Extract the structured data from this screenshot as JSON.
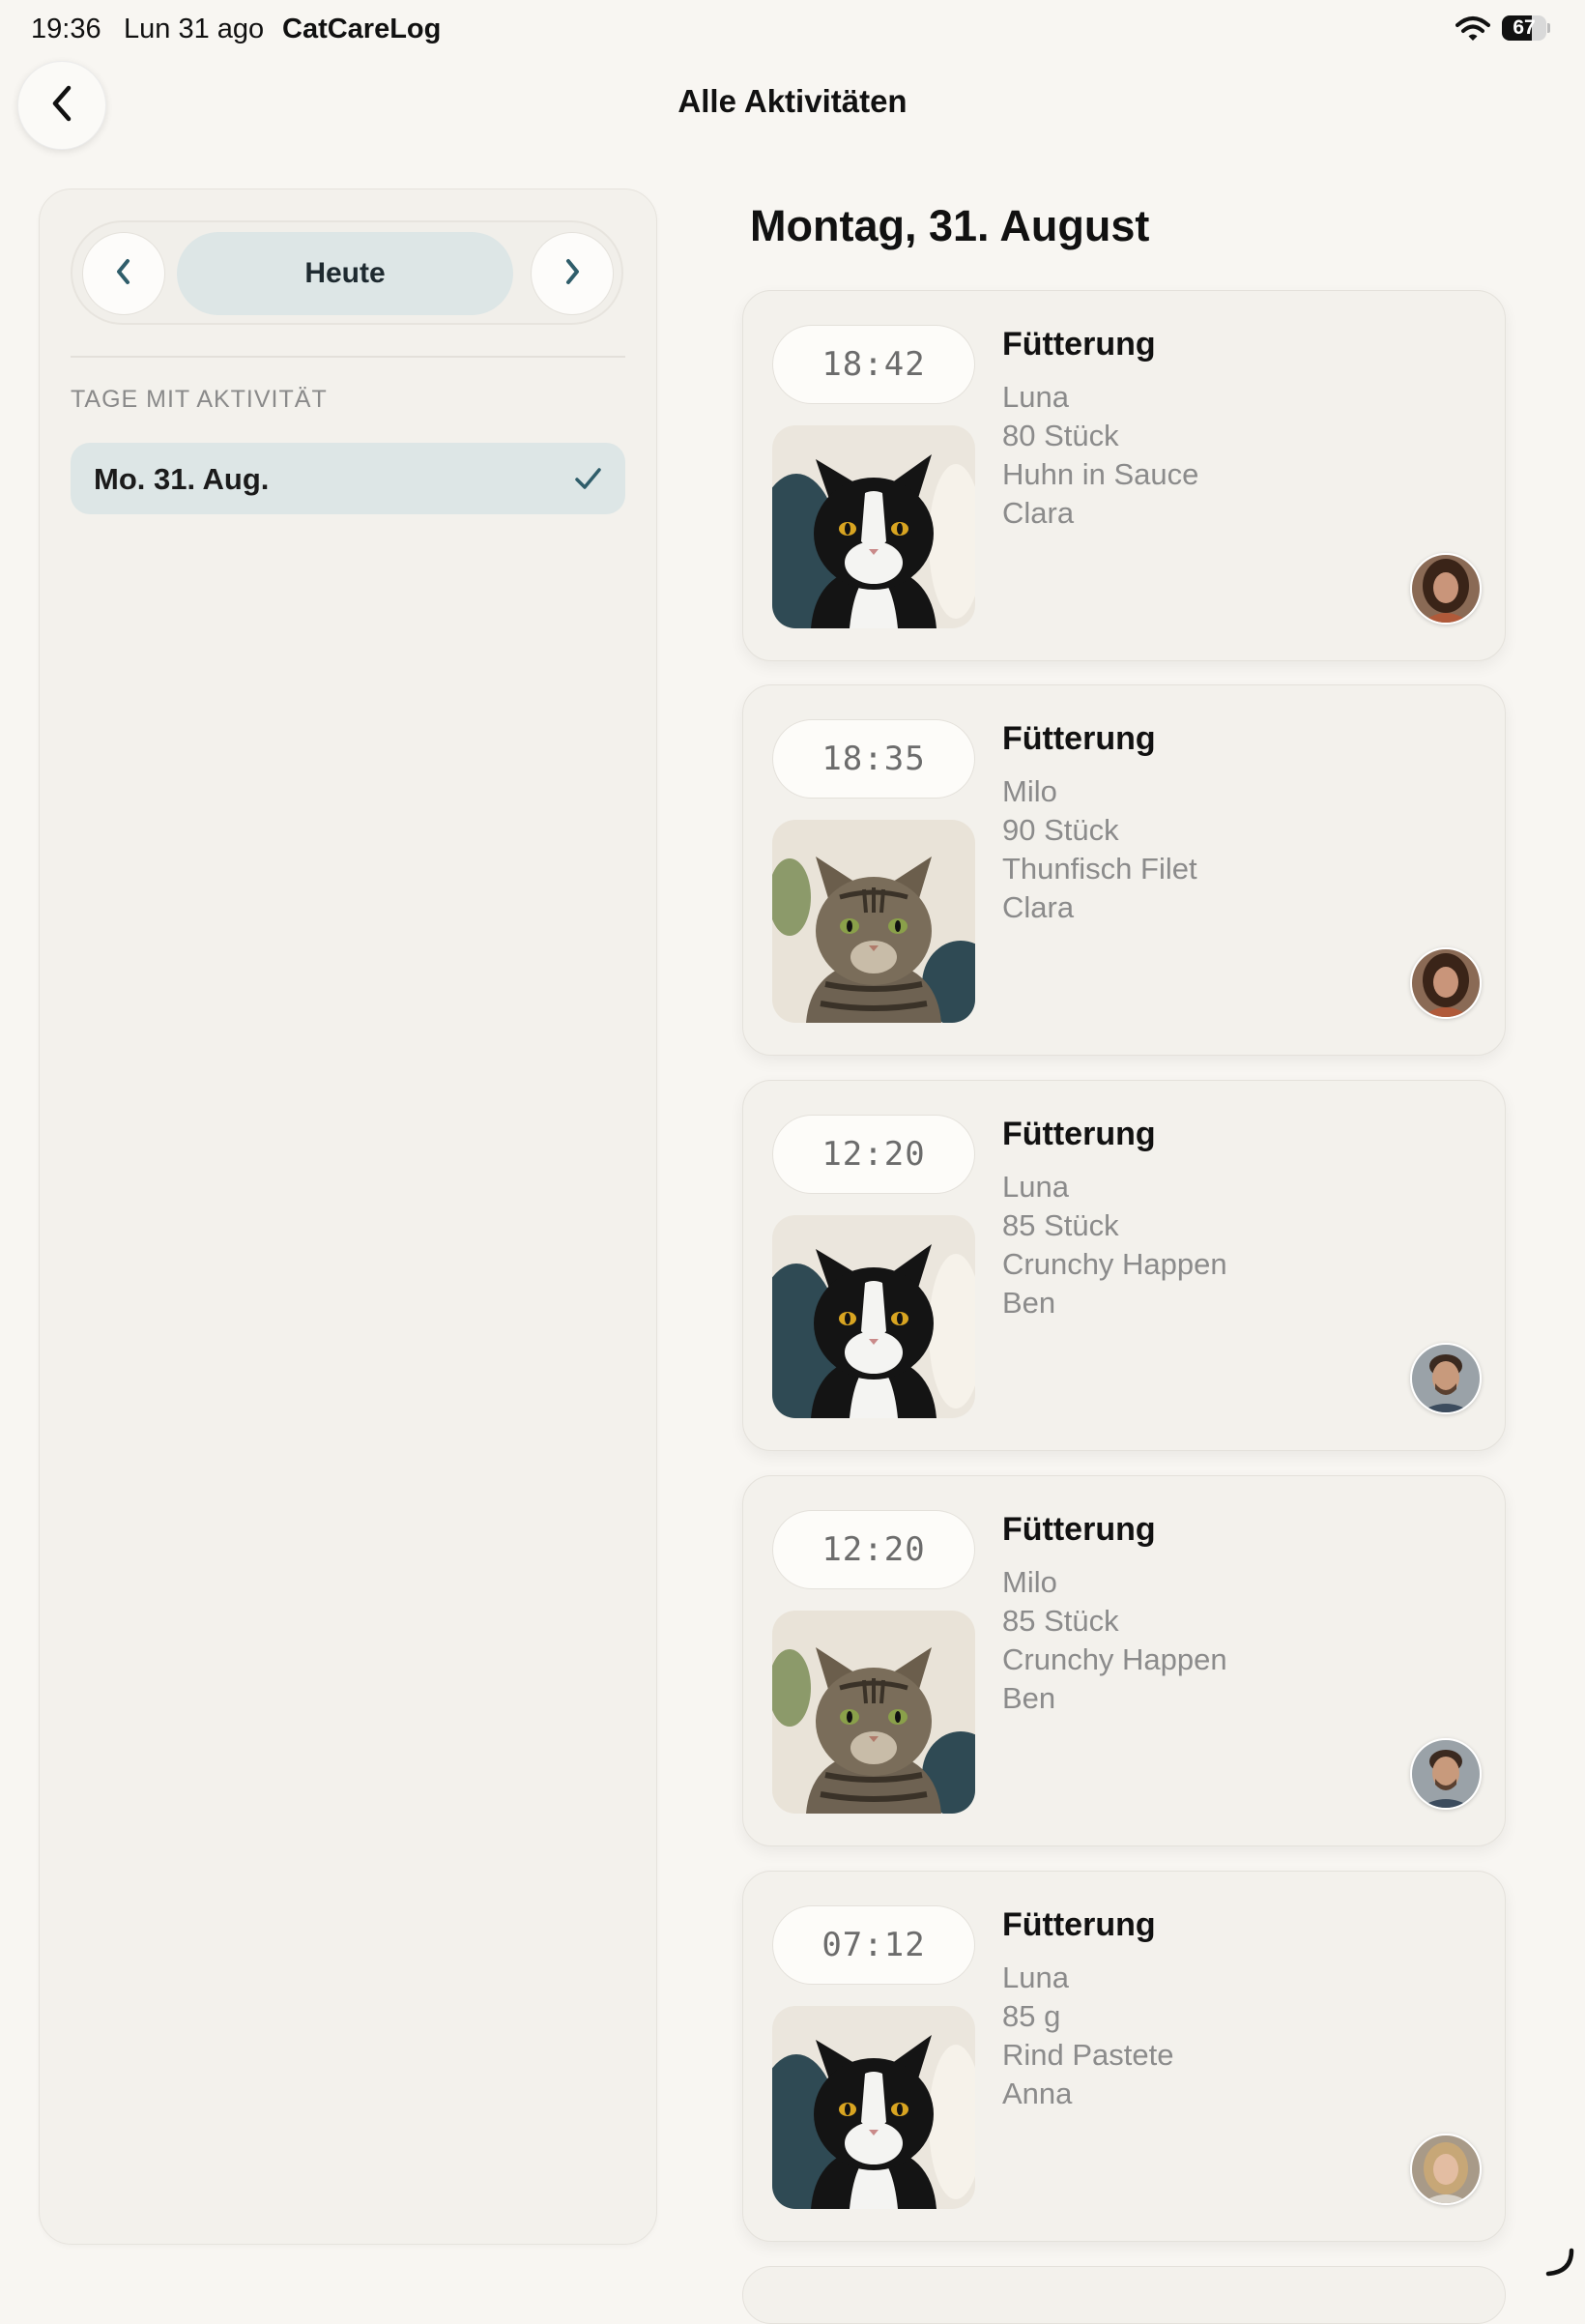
{
  "status_bar": {
    "time": "19:36",
    "date": "Lun 31 ago",
    "app_name": "CatCareLog",
    "battery_level": "67"
  },
  "header": {
    "title": "Alle Aktivitäten",
    "back_icon": "chevron-left-icon"
  },
  "sidebar": {
    "today_label": "Heute",
    "prev_icon": "chevron-left-icon",
    "next_icon": "chevron-right-icon",
    "section_title": "TAGE MIT AKTIVITÄT",
    "days": [
      {
        "label": "Mo. 31. Aug.",
        "selected": true
      }
    ]
  },
  "main": {
    "date_heading": "Montag, 31. August",
    "activities": [
      {
        "time": "18:42",
        "type": "Fütterung",
        "cat": "Luna",
        "amount": "80 Stück",
        "food": "Huhn in Sauce",
        "person": "Clara",
        "cat_photo": "tuxedo-cat-photo",
        "avatar": "clara-avatar"
      },
      {
        "time": "18:35",
        "type": "Fütterung",
        "cat": "Milo",
        "amount": "90 Stück",
        "food": "Thunfisch Filet",
        "person": "Clara",
        "cat_photo": "tabby-cat-photo",
        "avatar": "clara-avatar"
      },
      {
        "time": "12:20",
        "type": "Fütterung",
        "cat": "Luna",
        "amount": "85 Stück",
        "food": "Crunchy Happen",
        "person": "Ben",
        "cat_photo": "tuxedo-cat-photo",
        "avatar": "ben-avatar"
      },
      {
        "time": "12:20",
        "type": "Fütterung",
        "cat": "Milo",
        "amount": "85 Stück",
        "food": "Crunchy Happen",
        "person": "Ben",
        "cat_photo": "tabby-cat-photo",
        "avatar": "ben-avatar"
      },
      {
        "time": "07:12",
        "type": "Fütterung",
        "cat": "Luna",
        "amount": "85 g",
        "food": "Rind Pastete",
        "person": "Anna",
        "cat_photo": "tuxedo-cat-photo",
        "avatar": "anna-avatar"
      }
    ]
  },
  "colors": {
    "background": "#f8f6f2",
    "panel": "#f3f1ec",
    "accent_selected": "#dde6e6",
    "icon_teal": "#2f5d6a",
    "muted_text": "#8b8b8b"
  }
}
